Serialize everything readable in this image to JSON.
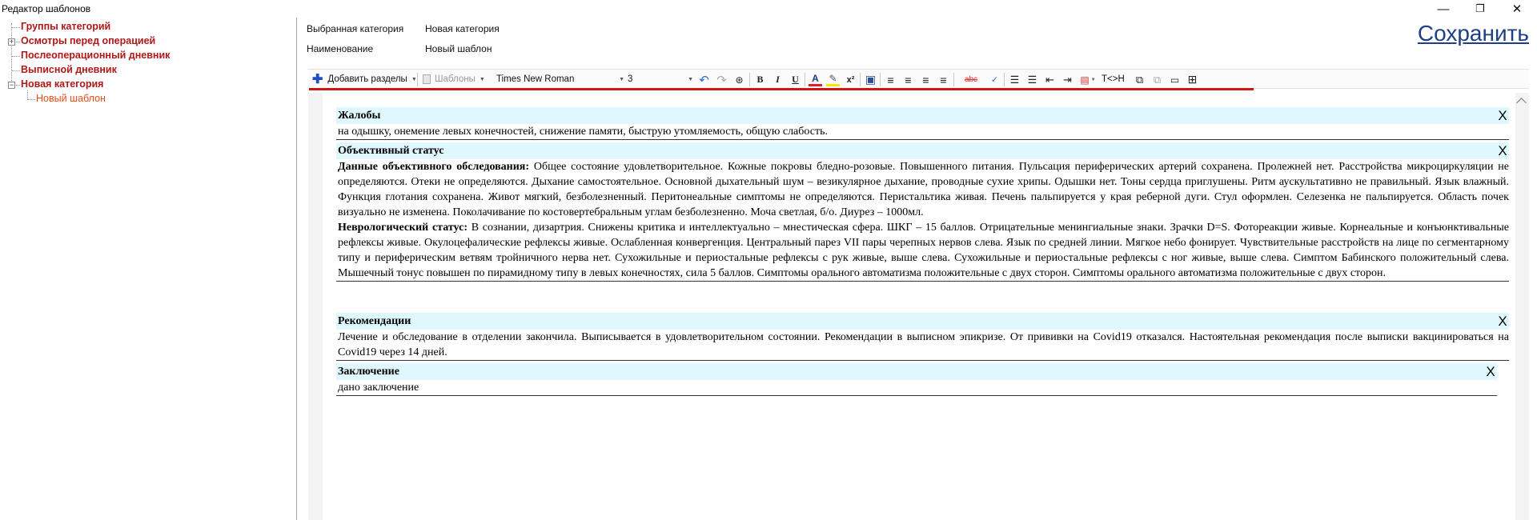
{
  "window": {
    "title": "Редактор шаблонов",
    "minimize": "—",
    "restore": "❐",
    "close": "✕"
  },
  "tree": {
    "items": [
      {
        "label": "Группы категорий"
      },
      {
        "label": "Осмотры перед операцией"
      },
      {
        "label": "Послеоперационный дневник"
      },
      {
        "label": "Выписной дневник"
      },
      {
        "label": "Новая категория"
      }
    ],
    "child": {
      "label": "Новый шаблон"
    }
  },
  "form": {
    "category_label": "Выбранная категория",
    "category_value": "Новая категория",
    "name_label": "Наименование",
    "name_value": "Новый шаблон"
  },
  "save_label": "Сохранить",
  "toolbar": {
    "add_sections": "Добавить разделы",
    "templates": "Шаблоны",
    "font": "Times New Roman",
    "size": "3",
    "text_html": "T<>H"
  },
  "icons": [
    "plus-icon",
    "undo-icon",
    "redo-icon",
    "binoculars-icon",
    "bold-icon",
    "italic-icon",
    "underline-icon",
    "font-color-icon",
    "highlight-icon",
    "superscript-icon",
    "image-icon",
    "align-left-icon",
    "align-center-icon",
    "align-right-icon",
    "justify-icon",
    "strike-icon",
    "spellcheck-icon",
    "numbered-list-icon",
    "bullet-list-icon",
    "outdent-icon",
    "indent-icon",
    "page-color-icon",
    "copy-icon",
    "paste-icon",
    "field-icon",
    "table-icon",
    "close-section-icon"
  ],
  "colors": {
    "tree_item": "#b01818",
    "tree_child": "#ee4a17",
    "save_link": "#1e3f86",
    "section_header_bg": "#dff8fd",
    "toolbar_underline": "#d01515"
  },
  "sections": [
    {
      "title": "Жалобы",
      "close": "X",
      "paragraphs": [
        {
          "bold": "",
          "text": "на одышку, онемение левых конечностей, снижение памяти, быструю утомляемость, общую слабость."
        }
      ]
    },
    {
      "title": "Объективный статус",
      "close": "X",
      "paragraphs": [
        {
          "bold": "Данные объективного обследования:",
          "text": " Общее состояние удовлетворительное. Кожные покровы бледно-розовые. Повышенного питания. Пульсация периферических артерий сохранена. Пролежней нет. Расстройства микроциркуляции не определяются. Отеки не определяются. Дыхание самостоятельное. Основной дыхательный шум – везикулярное дыхание, проводные сухие хрипы. Одышки нет. Тоны сердца приглушены. Ритм аускультативно не правильный. Язык влажный. Функция глотания сохранена. Живот мягкий, безболезненный. Перитонеальные симптомы не определяются. Перистальтика живая. Печень пальпируется у края реберной дуги. Стул оформлен. Селезенка не пальпируется. Область почек визуально не изменена. Поколачивание по костовертебральным углам безболезненно. Моча светлая, б/о. Диурез – 1000мл."
        },
        {
          "bold": "Неврологический статус:",
          "text": " В сознании, дизартрия. Снижены критика и интеллектуально – мнестическая сфера. ШКГ – 15 баллов. Отрицательные менингиальные знаки. Зрачки D=S. Фотореакции живые. Корнеальные и конъюнктивальные рефлексы живые. Окулоцефалические рефлексы живые. Ослабленная конвергенция. Центральный парез VII пары черепных нервов слева. Язык по средней линии. Мягкое небо фонирует. Чувствительные расстройств на лице по сегментарному типу и периферическим ветвям тройничного нерва нет. Сухожильные и периостальные рефлексы с рук живые, выше слева. Сухожильные и периостальные рефлексы с ног живые, выше слева. Симптом Бабинского положительный слева. Мышечный тонус повышен по пирамидному типу в левых конечностях, сила 5 баллов. Симптомы орального автоматизма положительные с двух сторон. Симптомы орального автоматизма положительные с двух сторон."
        }
      ]
    },
    {
      "title": "Рекомендации",
      "close": "X",
      "paragraphs": [
        {
          "bold": "",
          "text": "Лечение и обследование в отделении закончила. Выписывается в удовлетворительном  состоянии. Рекомендации в выписном эпикризе. От прививки  на Covid19 отказался. Настоятельная рекомендация после выписки вакцинироваться на Covid19 через 14 дней."
        }
      ]
    },
    {
      "title": "Заключение",
      "close": "X",
      "paragraphs": [
        {
          "bold": "",
          "text": "дано заключение"
        }
      ]
    }
  ]
}
